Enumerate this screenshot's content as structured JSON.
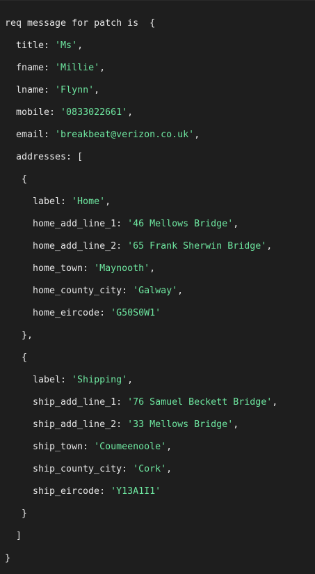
{
  "console": {
    "header": "req message for patch is  {",
    "title": "'Ms'",
    "fname": "'Millie'",
    "lname": "'Flynn'",
    "mobile": "'0833022661'",
    "email": "'breakbeat@verizon.co.uk'",
    "addresses_open": "addresses: [",
    "addresses": [
      {
        "label": "'Home'",
        "line1_key": "home_add_line_1: ",
        "line1": "'46 Mellows Bridge'",
        "line2_key": "home_add_line_2: ",
        "line2": "'65 Frank Sherwin Bridge'",
        "town_key": "home_town: ",
        "town": "'Maynooth'",
        "county_key": "home_county_city: ",
        "county": "'Galway'",
        "eircode_key": "home_eircode: ",
        "eircode": "'G50S0W1'"
      },
      {
        "label": "'Shipping'",
        "line1_key": "ship_add_line_1: ",
        "line1": "'76 Samuel Beckett Bridge'",
        "line2_key": "ship_add_line_2: ",
        "line2": "'33 Mellows Bridge'",
        "town_key": "ship_town: ",
        "town": "'Coumeenoole'",
        "county_key": "ship_county_city: ",
        "county": "'Cork'",
        "eircode_key": "ship_eircode: ",
        "eircode": "'Y13A1I1'"
      }
    ],
    "colors": {
      "background": "#1e1e1e",
      "text": "#e6e6e6",
      "string": "#6ee7a0"
    }
  }
}
